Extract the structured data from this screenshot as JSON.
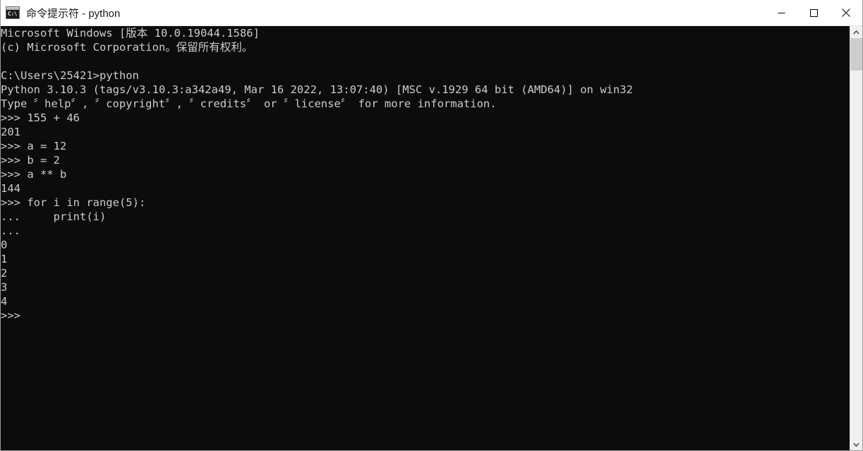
{
  "window": {
    "title": "命令提示符 - python",
    "icon": "cmd-icon",
    "icon_glyph": "C:\\",
    "controls": {
      "minimize": "minimize-button",
      "maximize": "maximize-button",
      "close": "close-button"
    }
  },
  "console": {
    "background_color": "#0c0c0c",
    "text_color": "#cccccc",
    "lines": [
      "Microsoft Windows [版本 10.0.19044.1586]",
      "(c) Microsoft Corporation。保留所有权利。",
      "",
      "C:\\Users\\25421>python",
      "Python 3.10.3 (tags/v3.10.3:a342a49, Mar 16 2022, 13:07:40) [MSC v.1929 64 bit (AMD64)] on win32",
      "Type 〞help〞, 〞copyright〞, 〞credits〞 or 〞license〞 for more information.",
      ">>> 155 + 46",
      "201",
      ">>> a = 12",
      ">>> b = 2",
      ">>> a ** b",
      "144",
      ">>> for i in range(5):",
      "...     print(i)",
      "...",
      "0",
      "1",
      "2",
      "3",
      "4",
      ">>>"
    ]
  },
  "scrollbar": {
    "up_arrow": "scroll-up-arrow-icon",
    "down_arrow": "scroll-down-arrow-icon",
    "thumb": "scrollbar-thumb",
    "track_color": "#f0f0f0",
    "thumb_color": "#cdcdcd"
  }
}
